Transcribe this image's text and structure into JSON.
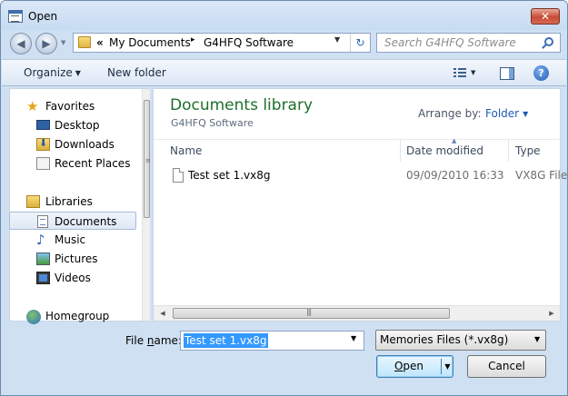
{
  "window": {
    "title": "Open",
    "close_glyph": "✕"
  },
  "navigation": {
    "back_icon": "back-arrow-icon",
    "forward_icon": "forward-arrow-icon"
  },
  "address_bar": {
    "overflow": "«",
    "crumbs": [
      "My Documents",
      "G4HFQ Software"
    ],
    "separator": "▸"
  },
  "search": {
    "placeholder": "Search G4HFQ Software"
  },
  "toolbar": {
    "organize": "Organize",
    "new_folder": "New folder"
  },
  "nav_pane": {
    "items": [
      {
        "label": "Favorites",
        "icon": "star-icon"
      },
      {
        "label": "Desktop",
        "icon": "desktop-icon"
      },
      {
        "label": "Downloads",
        "icon": "downloads-icon"
      },
      {
        "label": "Recent Places",
        "icon": "recent-places-icon"
      },
      {
        "label": "Libraries",
        "icon": "libraries-icon"
      },
      {
        "label": "Documents",
        "icon": "documents-icon",
        "selected": true
      },
      {
        "label": "Music",
        "icon": "music-icon"
      },
      {
        "label": "Pictures",
        "icon": "pictures-icon"
      },
      {
        "label": "Videos",
        "icon": "videos-icon"
      },
      {
        "label": "Homegroup",
        "icon": "homegroup-icon"
      }
    ]
  },
  "library": {
    "title": "Documents library",
    "subtitle": "G4HFQ Software",
    "arrange_by_label": "Arrange by:",
    "arrange_by_value": "Folder"
  },
  "columns": [
    "Name",
    "Date modified",
    "Type"
  ],
  "files": [
    {
      "name": "Test set 1.vx8g",
      "date_modified": "09/09/2010 16:33",
      "type": "VX8G File"
    }
  ],
  "footer": {
    "file_name_label_prefix": "File ",
    "file_name_label_underlined": "n",
    "file_name_label_suffix": "ame:",
    "file_name_value": "Test set 1.vx8g",
    "filter_value": "Memories Files (*.vx8g)",
    "open_label_underlined": "O",
    "open_label_rest": "pen",
    "cancel_label": "Cancel"
  },
  "colors": {
    "library_title": "#1e6f2a",
    "selection": "#3399ff",
    "link_blue": "#1f5bb6"
  }
}
